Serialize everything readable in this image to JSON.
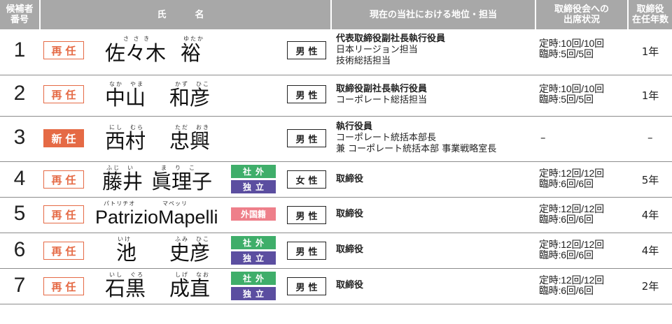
{
  "headers": {
    "number_l1": "候補者",
    "number_l2": "番号",
    "name": "氏　名",
    "position": "現在の当社における地位・担当",
    "attendance_l1": "取締役会への",
    "attendance_l2": "出席状況",
    "years_l1": "取締役",
    "years_l2": "在任年数"
  },
  "candidates": [
    {
      "number": "1",
      "status": "再任",
      "family_name": "佐々木",
      "given_name": "裕",
      "family_ruby": "さ さ き",
      "given_ruby": "ゆたか",
      "badges": [],
      "gender": "男性",
      "position_lines": [
        "代表取締役副社長執行役員",
        "日本リージョン担当",
        "技術総括担当"
      ],
      "attendance_regular": "定時:10回/10回",
      "attendance_special": "臨時:5回/5回",
      "years": "1年"
    },
    {
      "number": "2",
      "status": "再任",
      "family_name": "中山",
      "given_name": "和彦",
      "family_ruby": "なか　やま",
      "given_ruby": "かず　ひこ",
      "badges": [],
      "gender": "男性",
      "position_lines": [
        "取締役副社長執行役員",
        "コーポレート総括担当"
      ],
      "attendance_regular": "定時:10回/10回",
      "attendance_special": "臨時:5回/5回",
      "years": "1年"
    },
    {
      "number": "3",
      "status": "新任",
      "family_name": "西村",
      "given_name": "忠興",
      "family_ruby": "にし　むら",
      "given_ruby": "ただ　おき",
      "badges": [],
      "gender": "男性",
      "position_lines": [
        "執行役員",
        "コーポレート統括本部長",
        "兼 コーポレート統括本部 事業戦略室長"
      ],
      "attendance_dash": "–",
      "years_dash": "–"
    },
    {
      "number": "4",
      "status": "再任",
      "family_name": "藤井",
      "given_name": "眞理子",
      "family_ruby": "ふじ　い",
      "given_ruby": "ま　り　こ",
      "badges": [
        "社外",
        "独立"
      ],
      "gender": "女性",
      "position_lines": [
        "取締役"
      ],
      "attendance_regular": "定時:12回/12回",
      "attendance_special": "臨時:6回/6回",
      "years": "5年"
    },
    {
      "number": "5",
      "status": "再任",
      "family_name": "Patrizio",
      "given_name": "Mapelli",
      "family_ruby": "パトリチオ",
      "given_ruby": "マペッリ",
      "badges": [
        "外国籍"
      ],
      "gender": "男性",
      "position_lines": [
        "取締役"
      ],
      "attendance_regular": "定時:12回/12回",
      "attendance_special": "臨時:6回/6回",
      "years": "4年"
    },
    {
      "number": "6",
      "status": "再任",
      "family_name": "池",
      "given_name": "史彦",
      "family_ruby": "いけ",
      "given_ruby": "ふみ　ひこ",
      "badges": [
        "社外",
        "独立"
      ],
      "gender": "男性",
      "position_lines": [
        "取締役"
      ],
      "attendance_regular": "定時:12回/12回",
      "attendance_special": "臨時:6回/6回",
      "years": "4年"
    },
    {
      "number": "7",
      "status": "再任",
      "family_name": "石黒",
      "given_name": "成直",
      "family_ruby": "いし　ぐろ",
      "given_ruby": "しげ　なお",
      "badges": [
        "社外",
        "独立"
      ],
      "gender": "男性",
      "position_lines": [
        "取締役"
      ],
      "attendance_regular": "定時:12回/12回",
      "attendance_special": "臨時:6回/6回",
      "years": "2年"
    }
  ],
  "colors": {
    "header_bg": "#a8a8a8",
    "reappointment": "#e56a45",
    "outside": "#3fae6a",
    "independent": "#5b4ea0",
    "foreign": "#ee7f8a"
  }
}
